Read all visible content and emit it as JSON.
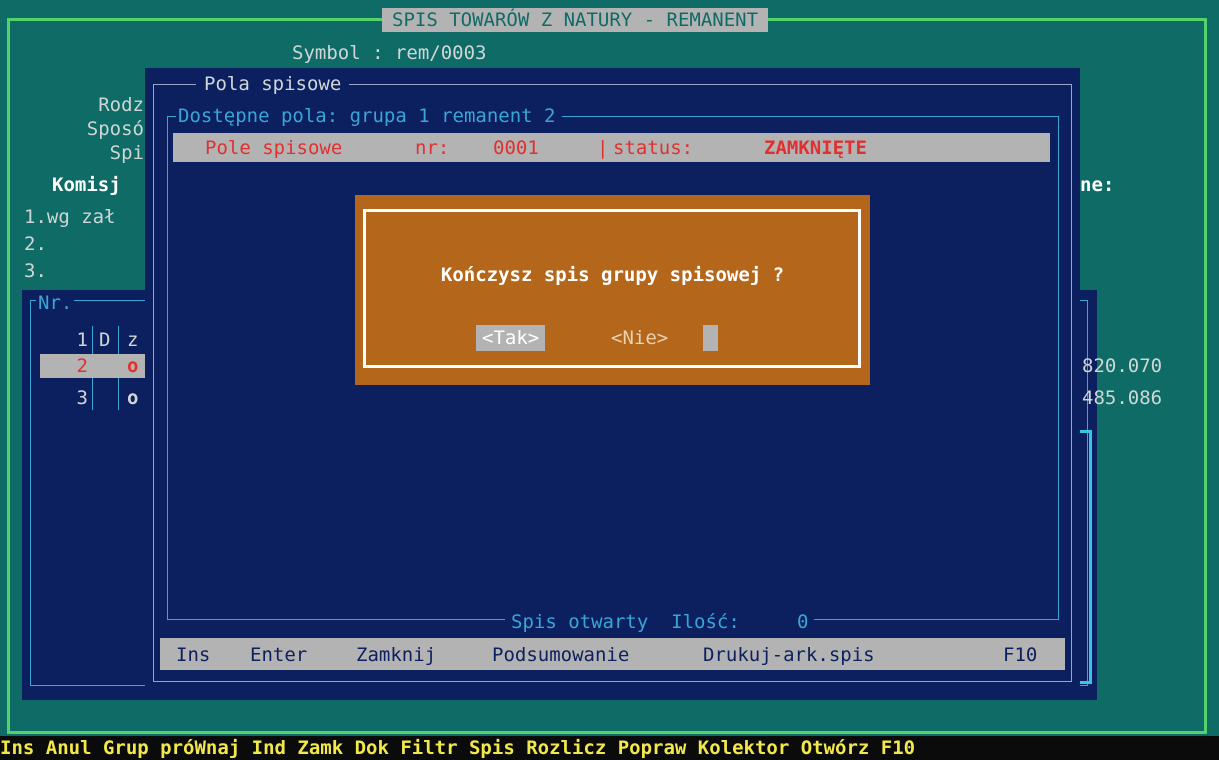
{
  "main": {
    "title": "SPIS TOWARÓW Z NATURY - REMANENT",
    "symbol_label": "Symbol : rem/0003",
    "labels_left": [
      "Rodz",
      "Sposó",
      "Spi"
    ],
    "komisja_label": "Komisj",
    "items": [
      "1.wg zał",
      "2.",
      "3."
    ],
    "right_label": "ne:",
    "list": {
      "header_nr": "Nr.",
      "header_row": {
        "n": "1",
        "c1": "D",
        "c2": "z"
      },
      "rows": [
        {
          "n": "2",
          "c2": "o",
          "value": "820.070",
          "selected": true
        },
        {
          "n": "3",
          "c2": "o",
          "value": "485.086",
          "selected": false
        }
      ]
    }
  },
  "pola": {
    "title": "Pola spisowe",
    "group_title": "Dostępne pola: grupa 1 remanent 2",
    "field_row": {
      "label": "Pole spisowe",
      "nr_label": "nr:",
      "nr_value": "0001",
      "separator": "|",
      "status_label": "status:",
      "status_value": "ZAMKNIĘTE"
    },
    "footer": {
      "status": "Spis otwarty",
      "qty_label": "Ilość:",
      "qty_value": "0"
    },
    "menu": [
      "Ins",
      "Enter",
      "Zamknij",
      "Podsumowanie",
      "Drukuj-ark.spis",
      "F10"
    ]
  },
  "confirm": {
    "question": "Kończysz spis grupy spisowej ?",
    "yes_label": "<Tak>",
    "no_label": "<Nie>"
  },
  "status_bar": {
    "text": "Ins Anul Grup próWnaj Ind Zamk Dok Filtr Spis Rozlicz Popraw Kolektor Otwórz F10"
  },
  "colors": {
    "teal_bg": "#0e6b66",
    "navy_bg": "#0c1f5f",
    "dialog_orange": "#b4661a",
    "accent_red": "#e03030",
    "status_yellow": "#f2e84a"
  }
}
